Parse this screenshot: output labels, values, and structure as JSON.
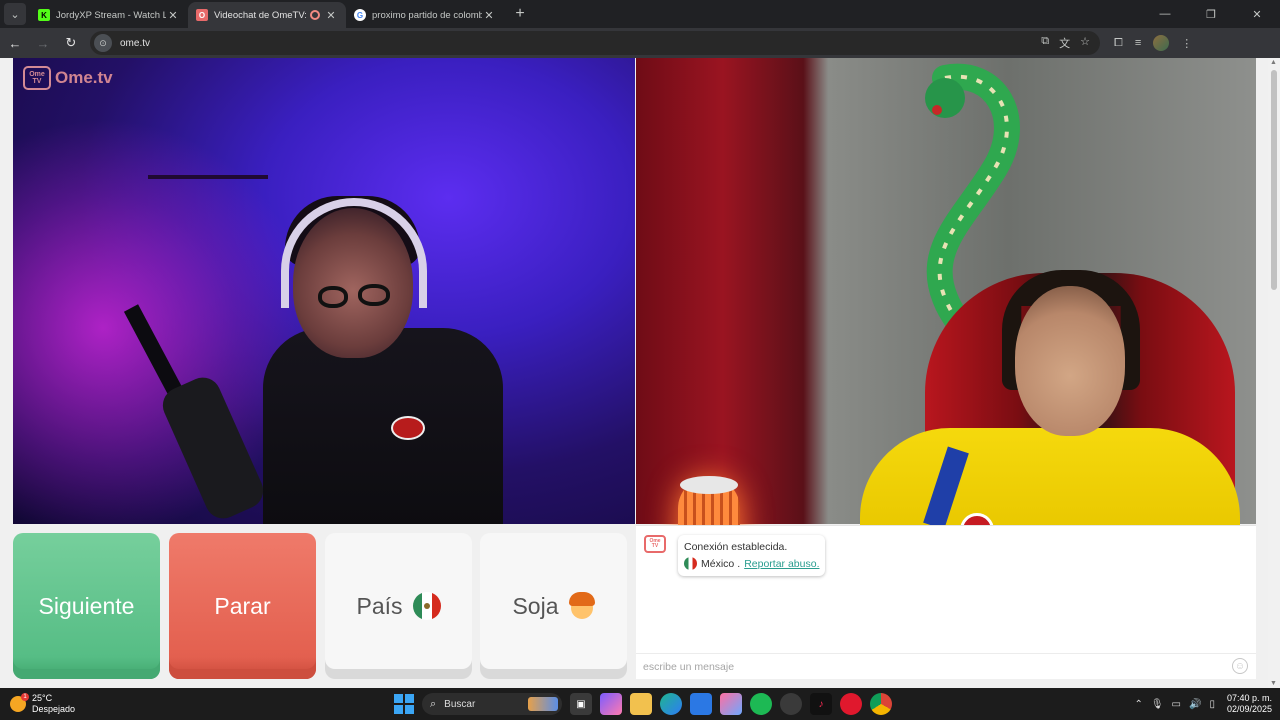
{
  "browser": {
    "tabs": [
      {
        "title": "JordyXP Stream - Watch Live on Kick",
        "favicon": "K",
        "favicon_color": "#53fc18",
        "active": false
      },
      {
        "title": "Videochat de OmeTV: una alternativa",
        "favicon": "O",
        "favicon_color": "#e86a6a",
        "active": true,
        "recording": true
      },
      {
        "title": "proximo partido de colombia - Buscar con Google",
        "favicon": "G",
        "favicon_color": "#ffffff",
        "active": false
      }
    ],
    "url": "ome.tv"
  },
  "ometv": {
    "logo_text": "Ome.tv",
    "logo_mark": "Ome TV",
    "buttons": {
      "next": "Siguiente",
      "stop": "Parar",
      "country": "País",
      "gender": "Soja"
    },
    "chat": {
      "connected": "Conexión establecida.",
      "country": "México",
      "country_sep": ".",
      "report": "Reportar abuso.",
      "input_placeholder": "escribe un mensaje"
    }
  },
  "taskbar": {
    "weather_temp": "25°C",
    "weather_desc": "Despejado",
    "weather_badge": "1",
    "search": "Buscar",
    "time": "07:40 p. m.",
    "date": "02/09/2025"
  },
  "colors": {
    "next": "#5cc58d",
    "stop": "#e8654f",
    "link": "#2a9d8f"
  }
}
